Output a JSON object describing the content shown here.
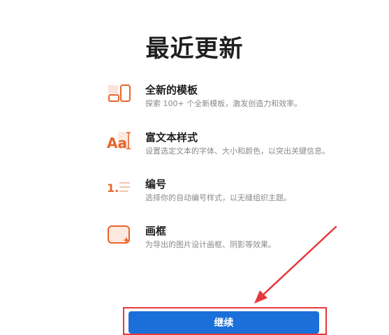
{
  "dialog": {
    "title": "最近更新",
    "features": [
      {
        "icon": "templates-icon",
        "title": "全新的模板",
        "description": "探索 100+ 个全新模板，激发创造力和效率。"
      },
      {
        "icon": "rich-text-icon",
        "title": "富文本样式",
        "description": "设置选定文本的字体、大小和颜色，以突出关键信息。"
      },
      {
        "icon": "numbering-icon",
        "title": "编号",
        "description": "选择你的自动编号样式，以无缝组织主题。"
      },
      {
        "icon": "frame-icon",
        "title": "画框",
        "description": "为导出的图片设计画框、阴影等效果。"
      }
    ],
    "continue_label": "继续"
  },
  "colors": {
    "accent": "#e8642c",
    "button": "#1a6fd8",
    "annotation": "#e5383b"
  }
}
